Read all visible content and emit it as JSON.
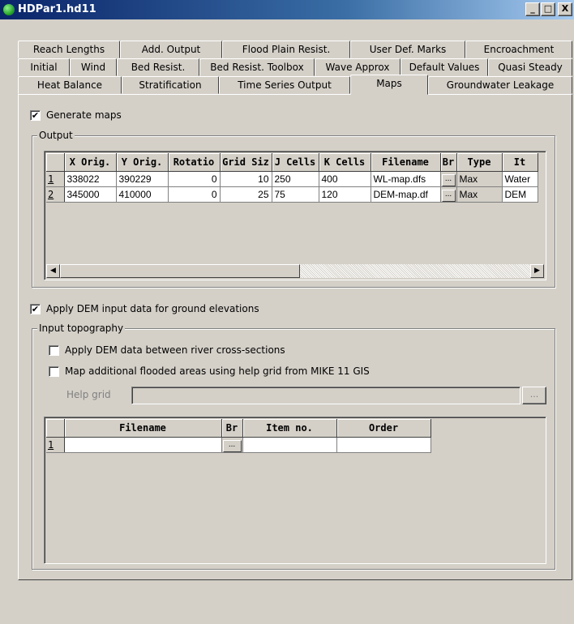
{
  "window": {
    "title": "HDPar1.hd11"
  },
  "titlebar_buttons": {
    "minimize": "_",
    "maximize": "□",
    "close": "X"
  },
  "tabs": {
    "row1": [
      "Reach Lengths",
      "Add. Output",
      "Flood Plain Resist.",
      "User Def. Marks",
      "Encroachment"
    ],
    "row2": [
      "Initial",
      "Wind",
      "Bed Resist.",
      "Bed Resist. Toolbox",
      "Wave Approx",
      "Default Values",
      "Quasi Steady"
    ],
    "row3": [
      "Heat Balance",
      "Stratification",
      "Time Series Output",
      "Maps",
      "Groundwater Leakage"
    ],
    "active": "Maps"
  },
  "maps": {
    "generate_maps": {
      "label": "Generate maps",
      "checked": true
    },
    "output_group": {
      "title": "Output"
    },
    "output_grid": {
      "columns": [
        "X Orig.",
        "Y Orig.",
        "Rotatio",
        "Grid Siz",
        "J Cells",
        "K Cells",
        "Filename",
        "Br",
        "Type",
        "It"
      ],
      "rows": [
        {
          "num": "1",
          "x": "338022",
          "y": "390229",
          "rot": "0",
          "grid": "10",
          "j": "250",
          "k": "400",
          "file": "WL-map.dfs",
          "br": "...",
          "type": "Max",
          "item": "Water"
        },
        {
          "num": "2",
          "x": "345000",
          "y": "410000",
          "rot": "0",
          "grid": "25",
          "j": "75",
          "k": "120",
          "file": "DEM-map.df",
          "br": "...",
          "type": "Max",
          "item": "DEM"
        }
      ]
    },
    "apply_dem": {
      "label": "Apply DEM input data for ground elevations",
      "checked": true
    },
    "input_topo_group": {
      "title": "Input topography"
    },
    "apply_dem_between": {
      "label": "Apply DEM data between river cross-sections",
      "checked": false
    },
    "map_flooded": {
      "label": "Map additional flooded areas using help grid from MIKE 11 GIS",
      "checked": false
    },
    "help_grid": {
      "label": "Help grid",
      "value": "",
      "browse": "..."
    },
    "topo_grid": {
      "columns": [
        "Filename",
        "Br",
        "Item no.",
        "Order"
      ],
      "rows": [
        {
          "num": "1",
          "file": "",
          "br": "...",
          "item": "",
          "order": ""
        }
      ]
    }
  }
}
